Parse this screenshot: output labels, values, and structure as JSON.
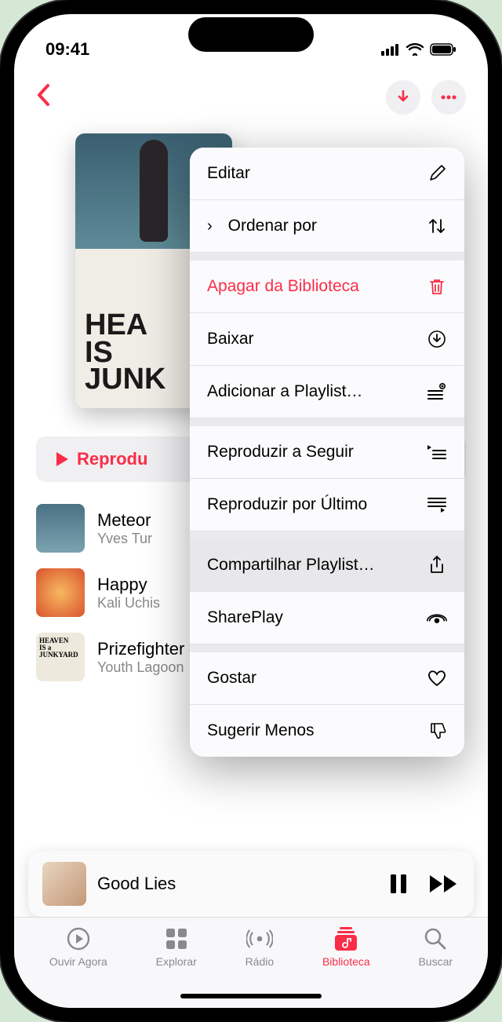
{
  "status": {
    "time": "09:41"
  },
  "header": {
    "download_icon": "download",
    "more_icon": "ellipsis"
  },
  "album_art_text": "HEA\nIS\nJUNK",
  "play_button_label": "Reprodu",
  "tracks": [
    {
      "title": "Meteor",
      "artist": "Yves Tur"
    },
    {
      "title": "Happy",
      "artist": "Kali Uchis"
    },
    {
      "title": "Prizefighter",
      "artist": "Youth Lagoon"
    }
  ],
  "now_playing": {
    "title": "Good Lies"
  },
  "tabs": {
    "listen": "Ouvir Agora",
    "browse": "Explorar",
    "radio": "Rádio",
    "library": "Biblioteca",
    "search": "Buscar"
  },
  "menu": {
    "edit": "Editar",
    "sort_by": "Ordenar por",
    "delete_from_library": "Apagar da Biblioteca",
    "download": "Baixar",
    "add_to_playlist": "Adicionar a Playlist…",
    "play_next": "Reproduzir a Seguir",
    "play_last": "Reproduzir por Último",
    "share_playlist": "Compartilhar Playlist…",
    "shareplay": "SharePlay",
    "like": "Gostar",
    "suggest_less": "Sugerir Menos"
  }
}
